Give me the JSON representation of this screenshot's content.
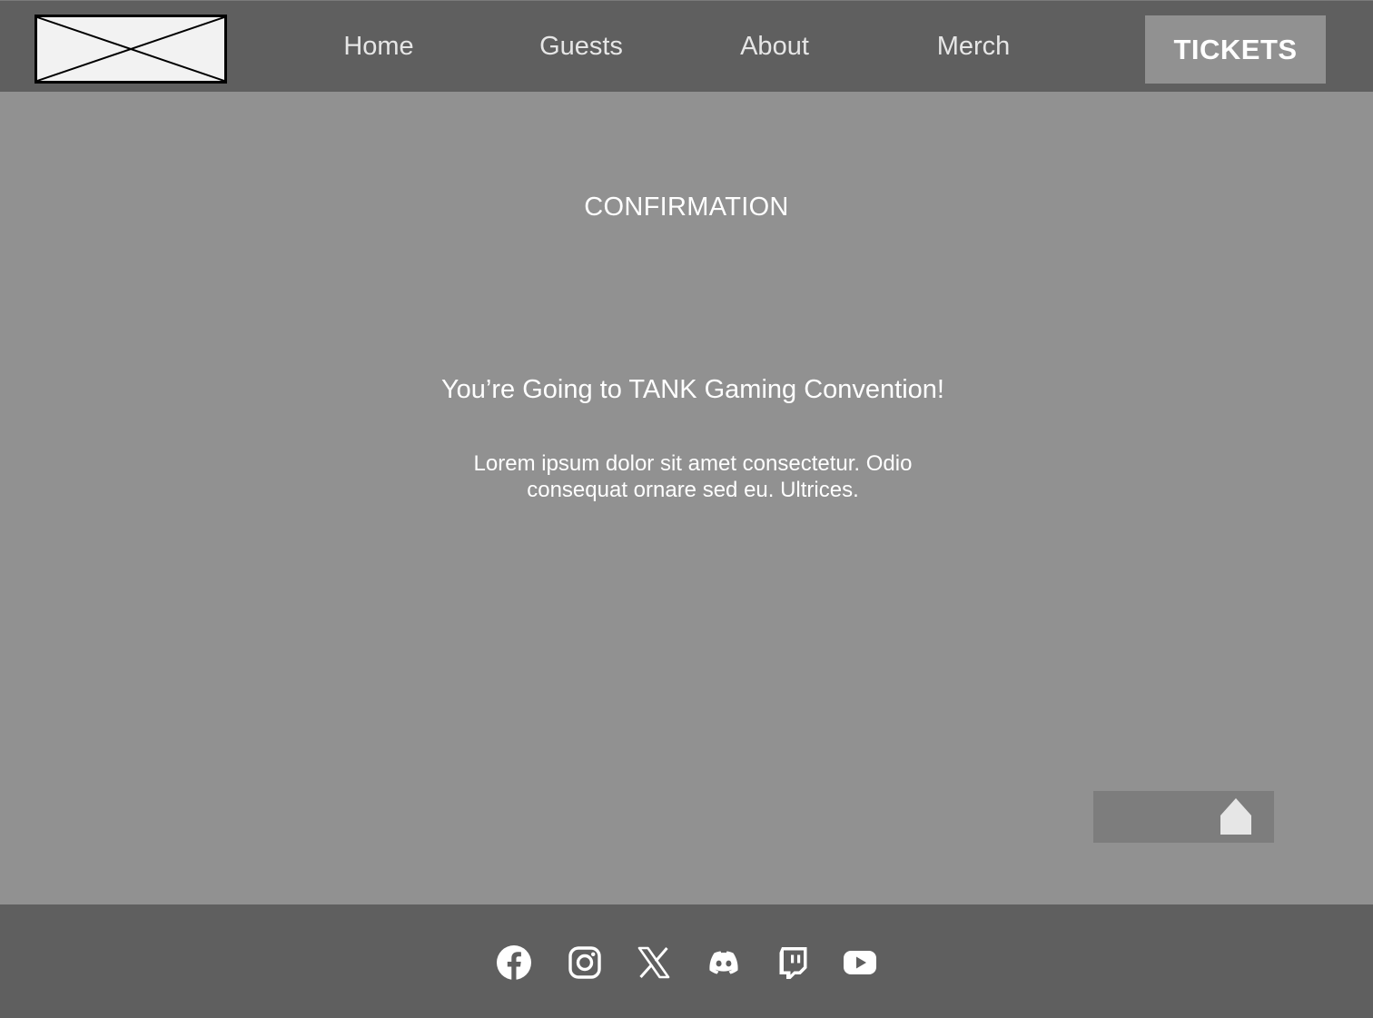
{
  "header": {
    "logo_icon": "image-placeholder-icon",
    "nav": {
      "home": "Home",
      "guests": "Guests",
      "about": "About",
      "merch": "Merch"
    },
    "tickets_label": "TICKETS"
  },
  "main": {
    "title": "CONFIRMATION",
    "headline": "You’re Going to TANK Gaming Convention!",
    "body": "Lorem ipsum dolor sit amet consectetur. Odio consequat ornare sed eu. Ultrices.",
    "back_to_top_icon": "arrow-up-icon"
  },
  "footer": {
    "social_icons": [
      "facebook-icon",
      "instagram-icon",
      "x-icon",
      "discord-icon",
      "twitch-icon",
      "youtube-icon"
    ]
  },
  "colors": {
    "header_bg": "#5f5f5f",
    "page_bg": "#919191",
    "button_bg": "#7d7d7d",
    "text": "#ffffff"
  }
}
